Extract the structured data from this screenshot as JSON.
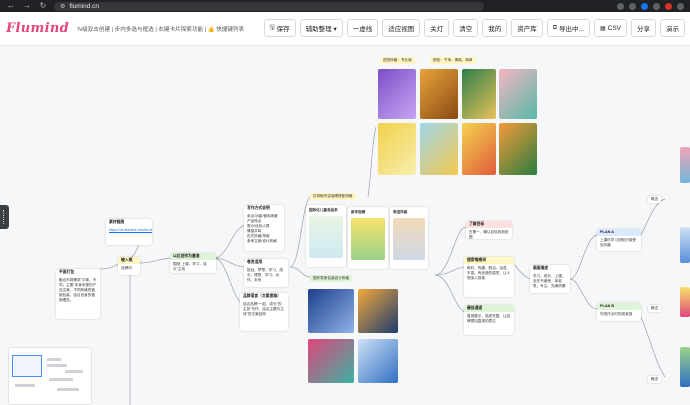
{
  "browser": {
    "url": "flumind.cn",
    "back": "←",
    "forward": "→",
    "reload": "↻"
  },
  "app": {
    "logo": "Flumind",
    "tagline": "'N级双击创建 | 步内多选与框选 | 右键卡片探索功能 | 👍 快捷键列表"
  },
  "toolbar": [
    {
      "label": "保存",
      "icon": "save-icon",
      "glyph": "🖫"
    },
    {
      "label": "辅助整理 ▾",
      "icon": "",
      "glyph": ""
    },
    {
      "label": "一虚线",
      "icon": "",
      "glyph": ""
    },
    {
      "label": "适应视图",
      "icon": "",
      "glyph": ""
    },
    {
      "label": "关灯",
      "icon": "",
      "glyph": ""
    },
    {
      "label": "清空",
      "icon": "",
      "glyph": ""
    },
    {
      "label": "我的",
      "icon": "",
      "glyph": ""
    },
    {
      "label": "资产库",
      "icon": "",
      "glyph": ""
    },
    {
      "label": "导出中...",
      "icon": "export-icon",
      "glyph": "⧉"
    },
    {
      "label": "CSV",
      "icon": "csv-icon",
      "glyph": "▦"
    },
    {
      "label": "分享",
      "icon": "",
      "glyph": ""
    },
    {
      "label": "演示",
      "icon": "",
      "glyph": ""
    }
  ],
  "mindmap": {
    "root_left": {
      "title": "平面打包",
      "body": "融合市场需求\"平衡，不同，主图\"本身来源的产品文案，不同风格的营销包装，结合自身的营销理念。"
    },
    "mid_node": {
      "title": "输入框",
      "body": "品牌词"
    },
    "link_node": {
      "title": "素材链接",
      "body": "https://ce.flumind.cn/s/sh.abs/gkuu/uskjd"
    },
    "center_node": {
      "title": "以红创作为基准",
      "body": "围绕\"上课，学习，成长\"主线"
    },
    "style_node": {
      "title": "写作方式说明",
      "items": [
        "卖点/功能/使用场景",
        "产品特点",
        "受众/目标人群",
        "情感共鸣",
        "形式风格/排版",
        "参考文案/设计风格"
      ]
    },
    "scene_node": {
      "title": "卷发适用",
      "body": "挑战、梦想、学习、成长、理想、学习、伙伴、未来"
    },
    "drag_node": {
      "title": "品牌语言（文案思路）",
      "body": "结合品牌\"一起，成长\"的主张\"写作，结合主题与主线\"的文案结构"
    },
    "img_tag_top": "视觉风格：专业版",
    "img_tag_top2": "颜色：干净、清爽、简单",
    "products_tag": "抗抑郁内容吸睛搭配风格",
    "group_labels": [
      "国际化儿童食品系",
      "新手指南",
      "简洁风格"
    ],
    "snack_tag": "国外零食包装设计风格",
    "right_node_1": {
      "title": "了解目标",
      "body": "在第一、确认目标找到依据"
    },
    "right_node_2": {
      "title": "搜索情感词",
      "body": "奇妙、有趣、鲜活、活泼、丰富、有创造的感觉，让人想深入探索"
    },
    "right_node_3": {
      "title": "最佳通道",
      "body": "直观展示、描述完整、让品牌更加直观的表达"
    },
    "right_center": {
      "title": "画面描述",
      "body": "学习，成长，上课，坐在书桌旁，拿起笔，专注、充满热情"
    },
    "plan_a": {
      "title": "PLAN A",
      "body": "上课时学习到知识感受到乐趣"
    },
    "plan_b": {
      "title": "PLAN B",
      "body": "完成作业时的成就感"
    },
    "edge_label_1": "概念",
    "edge_label_2": "概念",
    "edge_label_3": "概念"
  },
  "colors": {
    "logo_pink": "#e0457b",
    "logo_teal": "#3bb3a3",
    "link_line": "#9aa0a6",
    "minimap_view": "#4a8cf7"
  }
}
